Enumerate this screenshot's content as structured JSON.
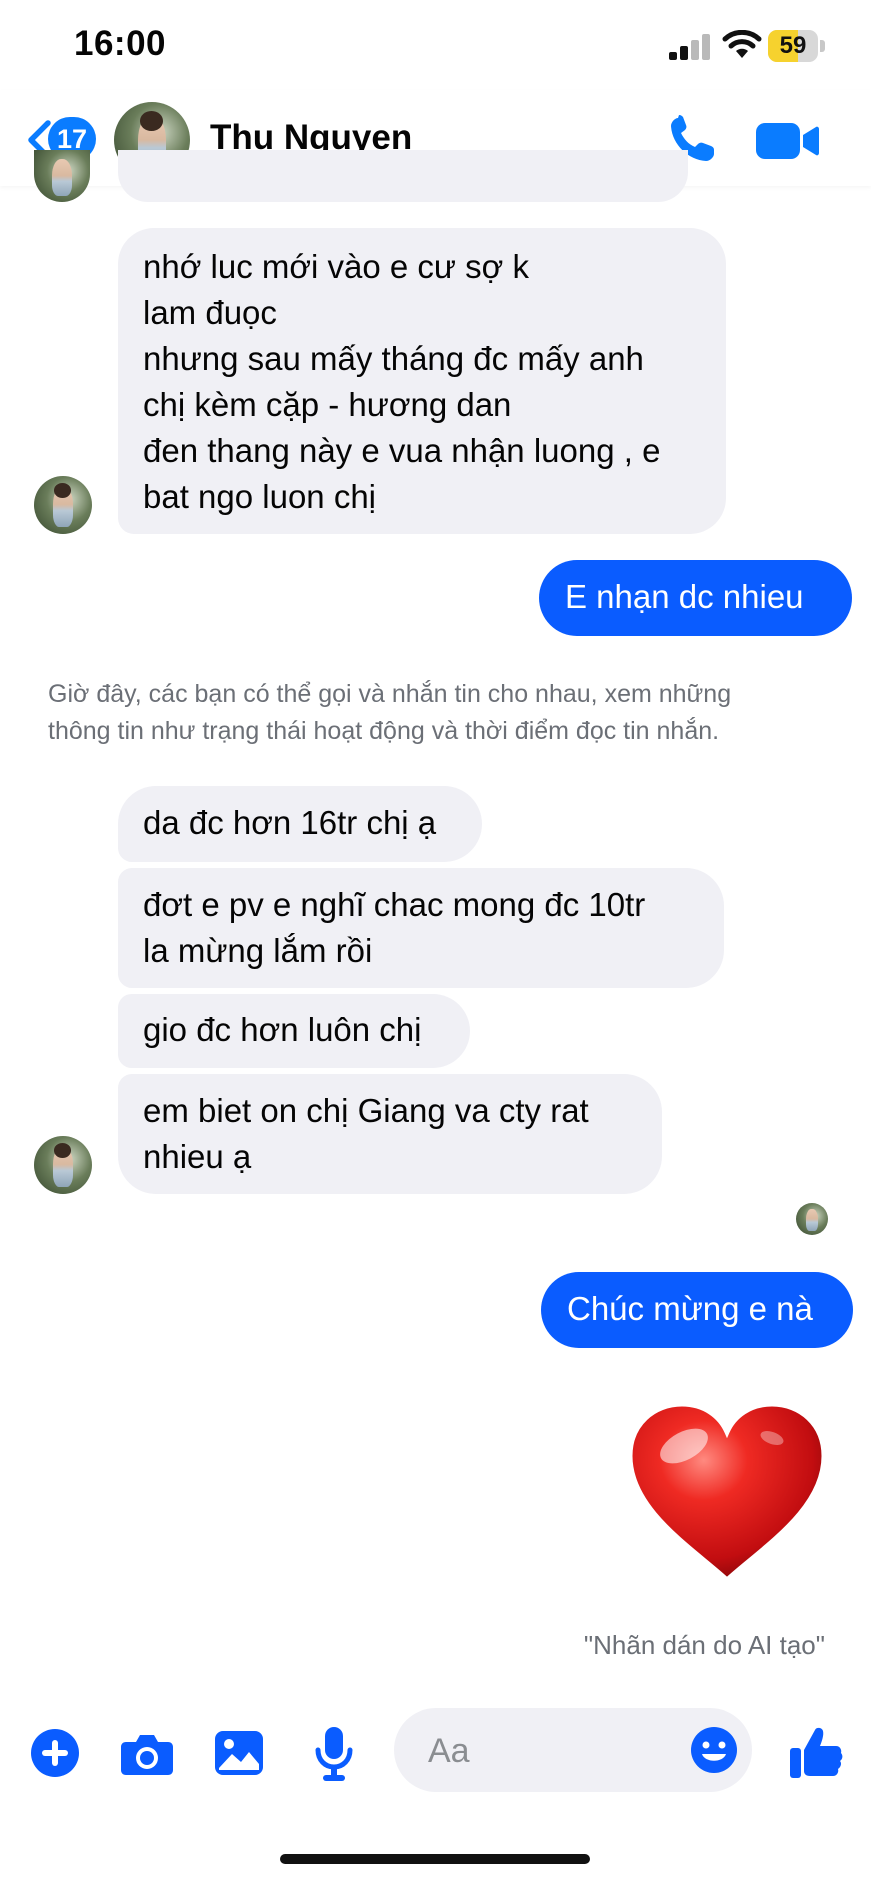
{
  "status_bar": {
    "time": "16:00",
    "battery": "59",
    "battery_level": 0.59,
    "icons": [
      "signal-icon",
      "wifi-icon",
      "battery-icon"
    ]
  },
  "header": {
    "back_count": "17",
    "contact_name": "Thu Nguyen",
    "icons": [
      "back-chevron-icon",
      "phone-icon",
      "video-camera-icon"
    ]
  },
  "messages": {
    "msg_1": {
      "lines": [
        "nhớ luc mới vào e cư sợ k",
        "lam đuọc",
        "nhưng sau mấy tháng đc mấy anh",
        "chị kèm cặp - hương dan",
        "đen thang này e vua nhận luong , e",
        "bat ngo luon chị"
      ]
    },
    "out_1": "E  nhạn dc nhieu",
    "system_notice": {
      "line1": "Giờ đây, các bạn có thể gọi và nhắn tin cho nhau, xem những",
      "line2": "thông tin như trạng thái hoạt động và thời điểm đọc tin nhắn."
    },
    "msg_2": "da đc hơn 16tr chị ạ",
    "msg_3": {
      "line1": "đơt e pv e nghĩ chac mong đc 10tr",
      "line2": "la mừng lắm rồi"
    },
    "msg_4": "gio đc hơn luôn chị",
    "msg_5": {
      "line1": "em biet on chị Giang va cty rat",
      "line2": "nhieu ạ"
    },
    "out_2": "Chúc mừng e nà",
    "sticker": "heart-sticker",
    "sticker_caption": "\"Nhãn dán do AI tạo\""
  },
  "composer": {
    "placeholder": "Aa",
    "icons": [
      "plus-icon",
      "camera-icon",
      "gallery-icon",
      "microphone-icon",
      "emoji-icon",
      "thumbs-up-icon"
    ]
  },
  "colors": {
    "accent": "#0a5cff",
    "header_icon": "#0a7cff",
    "incoming_bubble": "#f0f0f5",
    "battery_fill": "#f6d22e"
  }
}
